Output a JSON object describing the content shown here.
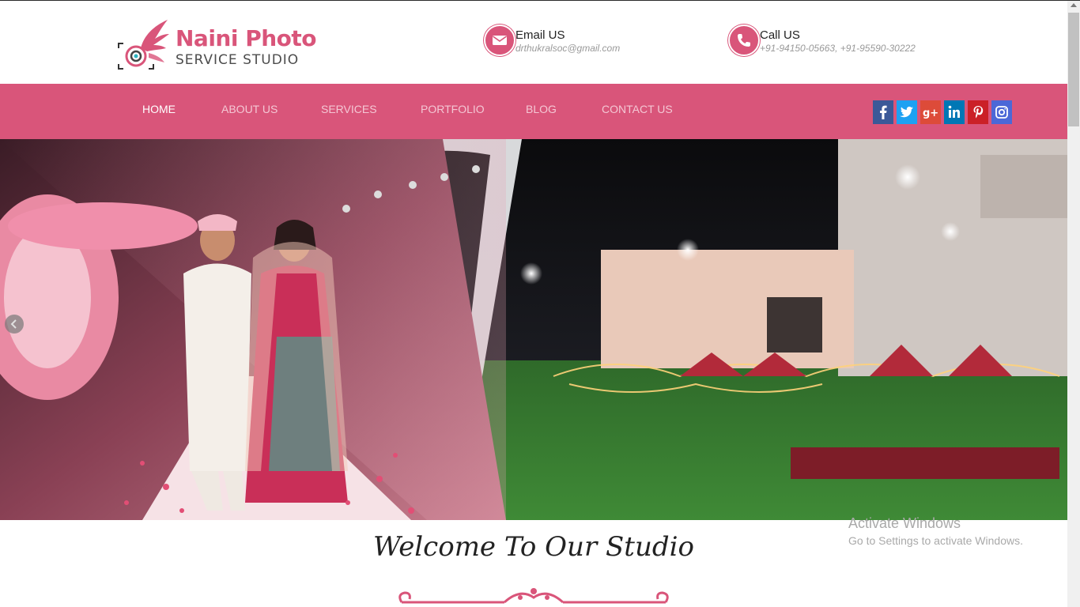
{
  "brand": {
    "title": "Naini Photo",
    "subtitle": "SERVICE STUDIO",
    "accent": "#d9557a"
  },
  "contact": {
    "email": {
      "label": "Email US",
      "value": "drthukralsoc@gmail.com",
      "icon": "envelope-icon"
    },
    "phone": {
      "label": "Call US",
      "value": "+91-94150-05663,  +91-95590-30222",
      "icon": "phone-icon"
    }
  },
  "nav": {
    "items": [
      {
        "label": "HOME",
        "active": true
      },
      {
        "label": "ABOUT US",
        "active": false
      },
      {
        "label": "SERVICES",
        "active": false
      },
      {
        "label": "PORTFOLIO",
        "active": false
      },
      {
        "label": "BLOG",
        "active": false
      },
      {
        "label": "CONTACT US",
        "active": false
      }
    ],
    "bar_color": "#d9557a"
  },
  "social": [
    {
      "name": "facebook",
      "color": "#3b5998"
    },
    {
      "name": "twitter",
      "color": "#1da1f2"
    },
    {
      "name": "google-plus",
      "color": "#dd4b39"
    },
    {
      "name": "linkedin",
      "color": "#0077b5"
    },
    {
      "name": "pinterest",
      "color": "#cb2027"
    },
    {
      "name": "instagram",
      "color": "#4c68d7"
    }
  ],
  "hero": {
    "description_icon": "wedding-venue-banner",
    "slider_arrow": "chevron-left-icon"
  },
  "welcome": {
    "heading": "Welcome To Our Studio"
  },
  "watermark": {
    "line1": "Activate Windows",
    "line2": "Go to Settings to activate Windows."
  }
}
